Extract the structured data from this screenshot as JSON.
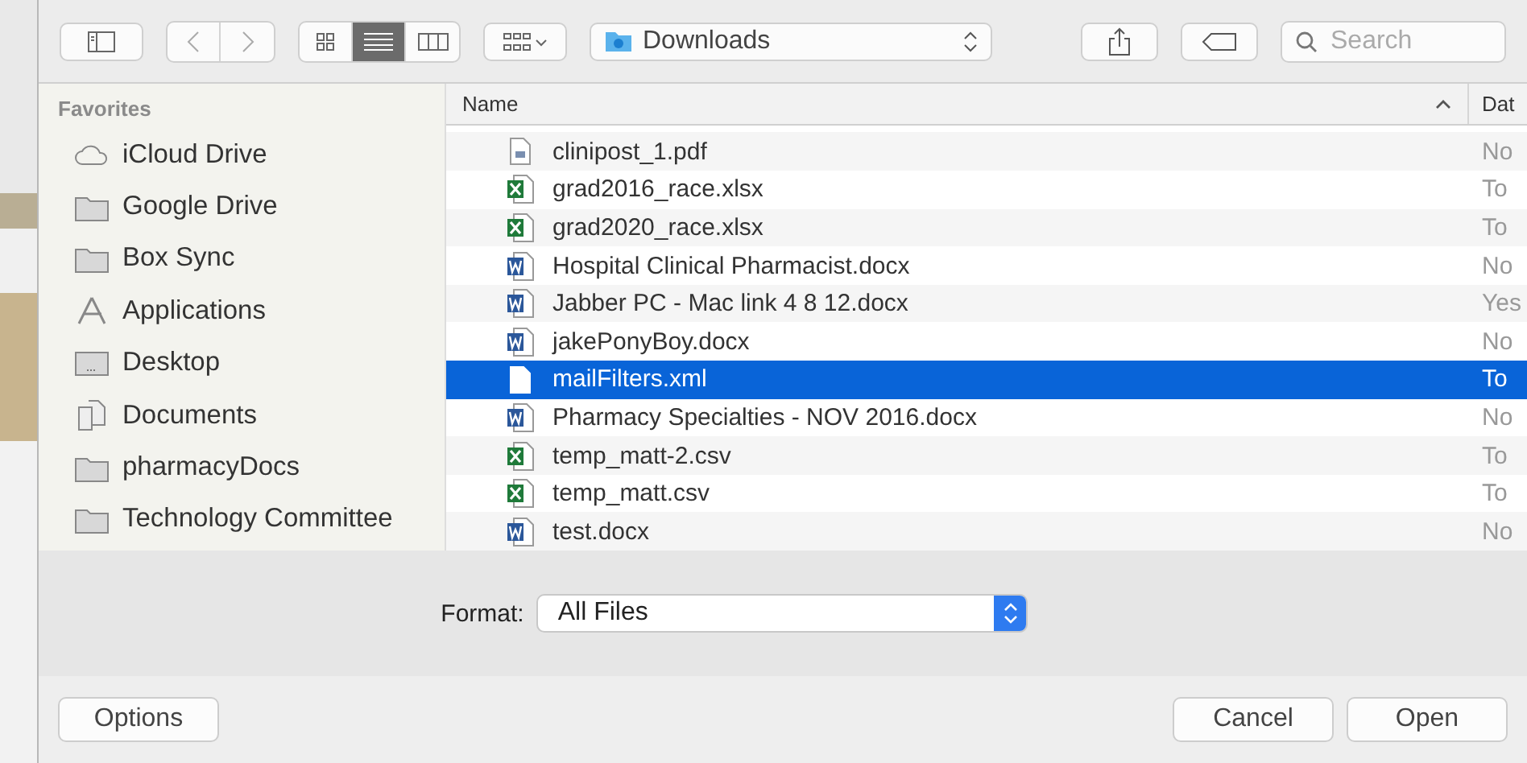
{
  "toolbar": {
    "view_modes": [
      {
        "kind": "icons",
        "selected": false
      },
      {
        "kind": "list",
        "selected": true
      },
      {
        "kind": "columns",
        "selected": false
      }
    ],
    "location": "Downloads",
    "search": {
      "placeholder": "Search"
    }
  },
  "sidebar": {
    "heading": "Favorites",
    "items": [
      {
        "label": "iCloud Drive",
        "kind": "cloud"
      },
      {
        "label": "Google Drive",
        "kind": "folder"
      },
      {
        "label": "Box Sync",
        "kind": "folder"
      },
      {
        "label": "Applications",
        "kind": "apps"
      },
      {
        "label": "Desktop",
        "kind": "desktop"
      },
      {
        "label": "Documents",
        "kind": "documents"
      },
      {
        "label": "pharmacyDocs",
        "kind": "folder"
      },
      {
        "label": "Technology Committee",
        "kind": "folder"
      }
    ]
  },
  "file_list": {
    "columns": [
      {
        "label": "Name",
        "sorted": true
      },
      {
        "label": "Dat"
      }
    ],
    "rows": [
      {
        "name": "clinipost_1.pdf",
        "kind": "pdf",
        "date": "No",
        "selected": false
      },
      {
        "name": "grad2016_race.xlsx",
        "kind": "excel",
        "date": "To",
        "selected": false
      },
      {
        "name": "grad2020_race.xlsx",
        "kind": "excel",
        "date": "To",
        "selected": false
      },
      {
        "name": "Hospital Clinical Pharmacist.docx",
        "kind": "word",
        "date": "No",
        "selected": false
      },
      {
        "name": "Jabber PC - Mac link 4 8 12.docx",
        "kind": "word",
        "date": "Yes",
        "selected": false
      },
      {
        "name": "jakePonyBoy.docx",
        "kind": "word",
        "date": "No",
        "selected": false
      },
      {
        "name": "mailFilters.xml",
        "kind": "plain",
        "date": "To",
        "selected": true
      },
      {
        "name": "Pharmacy Specialties - NOV 2016.docx",
        "kind": "word",
        "date": "No",
        "selected": false
      },
      {
        "name": "temp_matt-2.csv",
        "kind": "excel",
        "date": "To",
        "selected": false
      },
      {
        "name": "temp_matt.csv",
        "kind": "excel",
        "date": "To",
        "selected": false
      },
      {
        "name": "test.docx",
        "kind": "word",
        "date": "No",
        "selected": false
      }
    ]
  },
  "format": {
    "label": "Format:",
    "value": "All Files"
  },
  "buttons": {
    "options": "Options",
    "cancel": "Cancel",
    "open": "Open"
  }
}
